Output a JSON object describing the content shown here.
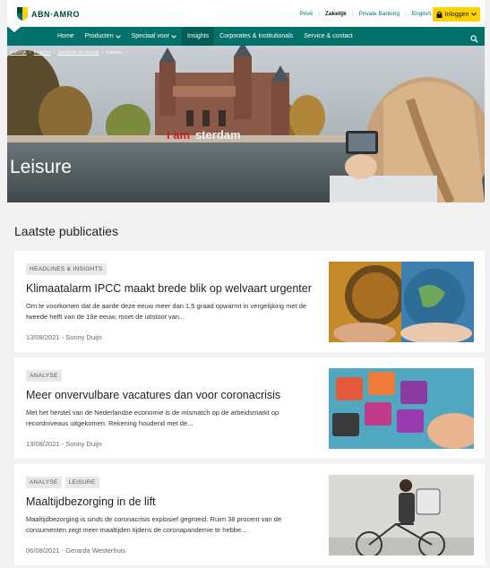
{
  "brand": {
    "name": "ABN·AMRO"
  },
  "utility_nav": {
    "links": [
      "Privé",
      "Zakelijk",
      "Private Banking",
      "English"
    ],
    "active": "Zakelijk",
    "login_label": "Inloggen"
  },
  "main_nav": {
    "items": [
      {
        "label": "Home",
        "dropdown": false,
        "active": false
      },
      {
        "label": "Producten",
        "dropdown": true,
        "active": false
      },
      {
        "label": "Speciaal voor",
        "dropdown": true,
        "active": false
      },
      {
        "label": "Insights",
        "dropdown": false,
        "active": true
      },
      {
        "label": "Corporates & Institutionals",
        "dropdown": false,
        "active": false
      },
      {
        "label": "Service & contact",
        "dropdown": false,
        "active": false
      }
    ]
  },
  "breadcrumb": [
    "Zakelijk",
    "Insights",
    "Sectoren en trends",
    "Leisure"
  ],
  "hero": {
    "title": "Leisure",
    "sign_text": "I amsterdam"
  },
  "section_title": "Laatste publicaties",
  "publications": [
    {
      "tags": [
        "HEADLINES & INSIGHTS"
      ],
      "title": "Klimaatalarm IPCC maakt brede blik op welvaart urgenter",
      "text": "Om te voorkomen dat de aarde deze eeuw meer dan 1,5 graad opwarmt in vergelijking met de tweede helft van de 19e eeuw, moet de uitstoot van...",
      "meta": "13/08/2021 - Sonny Duijn"
    },
    {
      "tags": [
        "ANALYSE"
      ],
      "title": "Meer onvervulbare vacatures dan voor coronacrisis",
      "text": "Met het herstel van de Nederlandse economie is de mismatch op de arbeidsmarkt op recordniveaus uitgekomen. Rekening houdend met de...",
      "meta": "13/08/2021 - Sonny Duijn"
    },
    {
      "tags": [
        "ANALYSE",
        "LEISURE"
      ],
      "title": "Maaltijdbezorging in de lift",
      "text": "Maaltijdbezorging is sinds de coronacrisis explosief gegroeid. Ruim 38 procent van de consumenten zegt meer maaltijden tijdens de coronapandemie te hebbe...",
      "meta": "06/08/2021 - Gerarda Westerhuis"
    }
  ],
  "colors": {
    "brand_green": "#00716b",
    "accent_yellow": "#ffd200"
  },
  "icons": [
    "abn-amro-shield-icon",
    "lock-icon",
    "chevron-down-icon",
    "search-icon"
  ]
}
